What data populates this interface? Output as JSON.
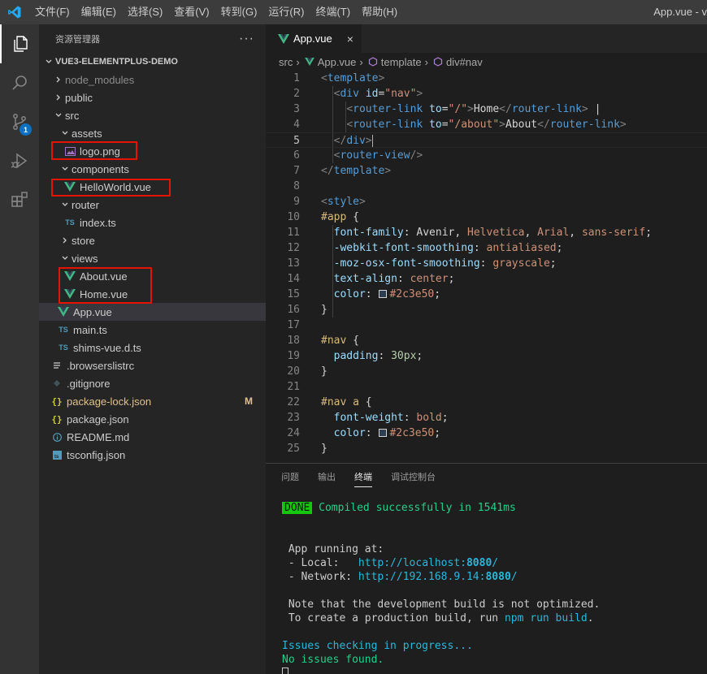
{
  "menu": [
    "文件(F)",
    "编辑(E)",
    "选择(S)",
    "查看(V)",
    "转到(G)",
    "运行(R)",
    "终端(T)",
    "帮助(H)"
  ],
  "window_title": "App.vue - v",
  "activity": {
    "items": [
      "explorer-icon",
      "search-icon",
      "source-control-icon",
      "run-debug-icon",
      "extensions-icon"
    ],
    "scm_badge": "1"
  },
  "sidebar": {
    "title": "资源管理器",
    "more": "···",
    "project": "VUE3-ELEMENTPLUS-DEMO",
    "tree": [
      {
        "label": "node_modules"
      },
      {
        "label": "public"
      },
      {
        "label": "src"
      },
      {
        "label": "assets"
      },
      {
        "label": "logo.png"
      },
      {
        "label": "components"
      },
      {
        "label": "HelloWorld.vue"
      },
      {
        "label": "router"
      },
      {
        "label": "index.ts",
        "icon": "TS"
      },
      {
        "label": "store"
      },
      {
        "label": "views"
      },
      {
        "label": "About.vue"
      },
      {
        "label": "Home.vue"
      },
      {
        "label": "App.vue"
      },
      {
        "label": "main.ts",
        "icon": "TS"
      },
      {
        "label": "shims-vue.d.ts",
        "icon": "TS"
      },
      {
        "label": ".browserslistrc"
      },
      {
        "label": ".gitignore"
      },
      {
        "label": "package-lock.json",
        "icon": "{}",
        "status": "M"
      },
      {
        "label": "package.json",
        "icon": "{}"
      },
      {
        "label": "README.md"
      },
      {
        "label": "tsconfig.json"
      }
    ]
  },
  "editor": {
    "tab": {
      "label": "App.vue",
      "close": "×"
    },
    "breadcrumb": [
      "src",
      "App.vue",
      "template",
      "div#nav"
    ],
    "lines": [
      "1",
      "2",
      "3",
      "4",
      "5",
      "6",
      "7",
      "8",
      "9",
      "10",
      "11",
      "12",
      "13",
      "14",
      "15",
      "16",
      "17",
      "18",
      "19",
      "20",
      "21",
      "22",
      "23",
      "24",
      "25"
    ],
    "code": {
      "l1_tag": "template",
      "l2_tag": "div",
      "l2_attr": "id",
      "l2_val": "\"nav\"",
      "l3_tag": "router-link",
      "l3_attr": "to",
      "l3_val": "\"/\"",
      "l3_text": "Home",
      "l3_pipe": " |",
      "l4_tag": "router-link",
      "l4_attr": "to",
      "l4_val": "\"/about\"",
      "l4_text": "About",
      "l5_tag": "div",
      "l6_tag": "router-view",
      "l7_tag": "template",
      "l9_tag": "style",
      "l10_sel": "#app",
      "l11_prop": "font-family",
      "l11_v1": "Avenir",
      "l11_v2": "Helvetica",
      "l11_v3": "Arial",
      "l11_v4": "sans-serif",
      "l12_prop": "-webkit-font-smoothing",
      "l12_val": "antialiased",
      "l13_prop": "-moz-osx-font-smoothing",
      "l13_val": "grayscale",
      "l14_prop": "text-align",
      "l14_val": "center",
      "l15_prop": "color",
      "l15_val": "#2c3e50",
      "l18_sel": "#nav",
      "l19_prop": "padding",
      "l19_val": "30px",
      "l22_sel": "#nav a",
      "l23_prop": "font-weight",
      "l23_val": "bold",
      "l24_prop": "color",
      "l24_val": "#2c3e50"
    },
    "swatch_color": "#2c3e50"
  },
  "panel": {
    "tabs": [
      "问题",
      "输出",
      "终端",
      "调试控制台"
    ],
    "active_tab": "终端",
    "terminal": {
      "done_badge": "DONE",
      "compiled": "Compiled successfully in 1541ms",
      "running": "App running at:",
      "local_label": "- Local:   ",
      "local_url_host": "http://localhost:",
      "local_url_port": "8080",
      "local_url_slash": "/",
      "network_label": "- Network: ",
      "network_url_host": "http://192.168.9.14:",
      "network_url_port": "8080",
      "network_url_slash": "/",
      "note1": "Note that the development build is not optimized.",
      "note2_pre": "To create a production build, run ",
      "note2_cmd": "npm run build",
      "note2_post": ".",
      "issues": "Issues checking in progress...",
      "no_issues": "No issues found."
    }
  },
  "colors": {
    "accent": "#007acc",
    "vue_green": "#41b883",
    "highlight_box": "#e51400"
  }
}
